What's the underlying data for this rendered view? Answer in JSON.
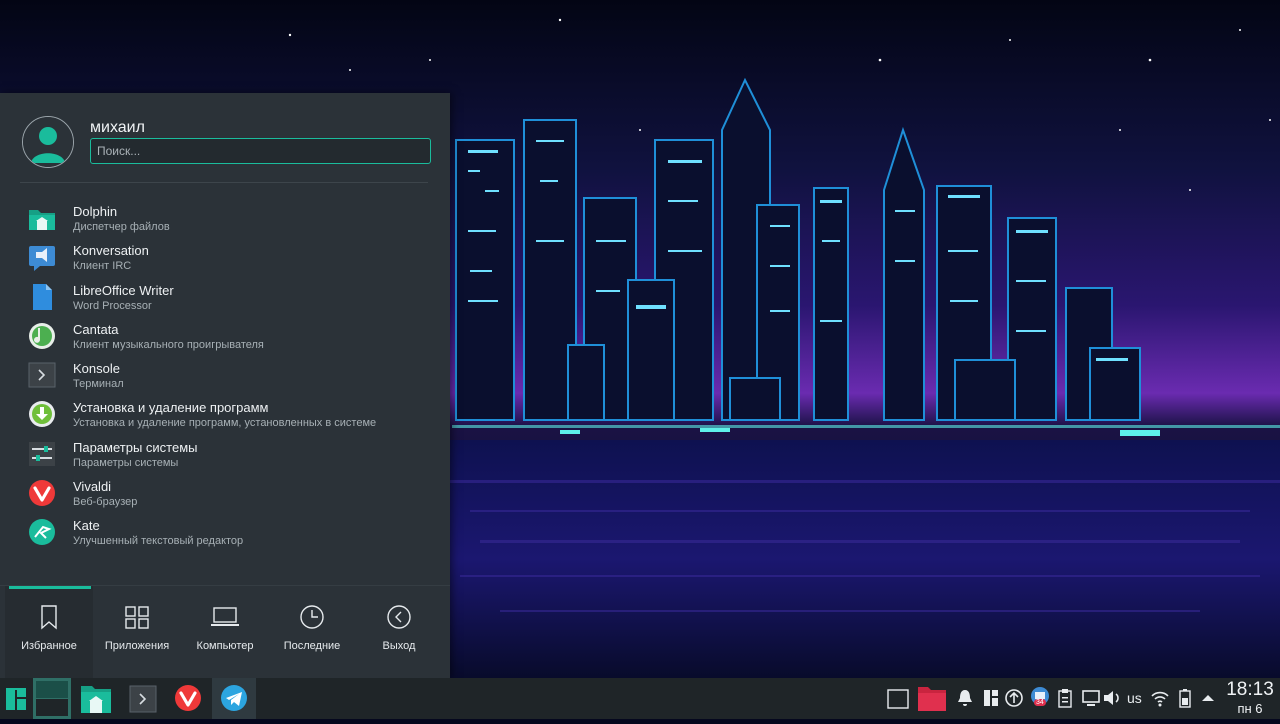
{
  "user": {
    "name": "михаил"
  },
  "search": {
    "placeholder": "Поиск..."
  },
  "apps": [
    {
      "name": "Dolphin",
      "desc": "Диспетчер файлов",
      "icon": "folder-icon",
      "color": "#1abc9c"
    },
    {
      "name": "Konversation",
      "desc": "Клиент IRC",
      "icon": "chat-icon",
      "color": "#3d8bd4"
    },
    {
      "name": "LibreOffice Writer",
      "desc": "Word Processor",
      "icon": "document-icon",
      "color": "#2f8dde"
    },
    {
      "name": "Cantata",
      "desc": "Клиент музыкального проигрывателя",
      "icon": "music-icon",
      "color": "#4caf50"
    },
    {
      "name": "Konsole",
      "desc": "Терминал",
      "icon": "terminal-icon",
      "color": "#3c4247"
    },
    {
      "name": "Установка и удаление программ",
      "desc": "Установка и удаление программ, установленных в системе",
      "icon": "download-icon",
      "color": "#6fbf3a"
    },
    {
      "name": "Параметры системы",
      "desc": "Параметры системы",
      "icon": "settings-icon",
      "color": "#3c4247"
    },
    {
      "name": "Vivaldi",
      "desc": "Веб-браузер",
      "icon": "vivaldi-icon",
      "color": "#ef3939"
    },
    {
      "name": "Kate",
      "desc": "Улучшенный текстовый редактор",
      "icon": "kate-icon",
      "color": "#1abc9c"
    }
  ],
  "tabs": [
    {
      "label": "Избранное",
      "icon": "bookmark-icon",
      "active": true
    },
    {
      "label": "Приложения",
      "icon": "grid-icon"
    },
    {
      "label": "Компьютер",
      "icon": "laptop-icon"
    },
    {
      "label": "Последние",
      "icon": "clock-icon"
    },
    {
      "label": "Выход",
      "icon": "leave-icon"
    }
  ],
  "tray": {
    "lang": "us",
    "badge": "34"
  },
  "clock": {
    "time": "18:13",
    "date": "пн 6"
  },
  "colors": {
    "accent": "#1abc9c",
    "menu_bg": "#2b3238",
    "panel_bg": "#1f2528"
  }
}
